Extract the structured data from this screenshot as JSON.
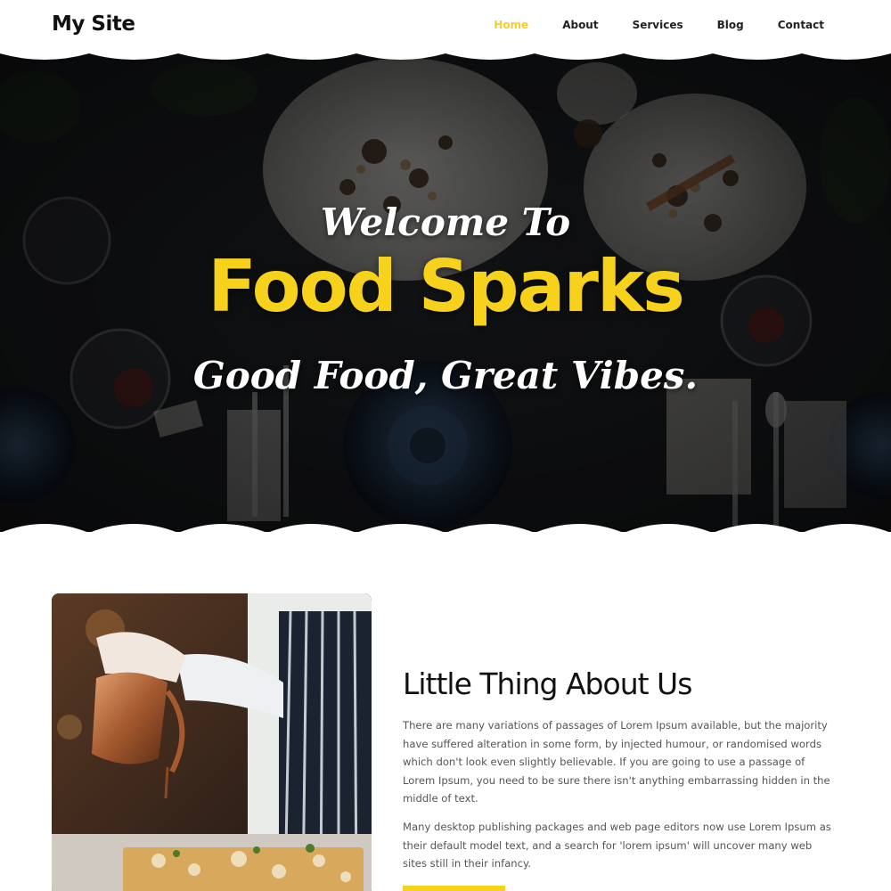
{
  "header": {
    "logo": "My Site",
    "nav": [
      {
        "label": "Home",
        "active": true
      },
      {
        "label": "About",
        "active": false
      },
      {
        "label": "Services",
        "active": false
      },
      {
        "label": "Blog",
        "active": false
      },
      {
        "label": "Contact",
        "active": false
      }
    ]
  },
  "hero": {
    "welcome": "Welcome To",
    "title": "Food Sparks",
    "tagline": "Good Food, Great Vibes."
  },
  "about": {
    "title": "Little Thing About Us",
    "paragraphs": [
      "There are many variations of passages of Lorem Ipsum available, but the majority have suffered alteration in some form, by injected humour, or randomised words which don't look even slightly believable. If you are going to use a passage of Lorem Ipsum, you need to be sure there isn't anything embarrassing hidden in the middle of text.",
      "Many desktop publishing packages and web page editors now use Lorem Ipsum as their default model text, and a search for 'lorem ipsum' will uncover many web sites still in their infancy."
    ]
  },
  "colors": {
    "accent": "#f7d21d",
    "hero_dark": "#15171a",
    "text_dark": "#111111",
    "text_body": "#555555"
  }
}
